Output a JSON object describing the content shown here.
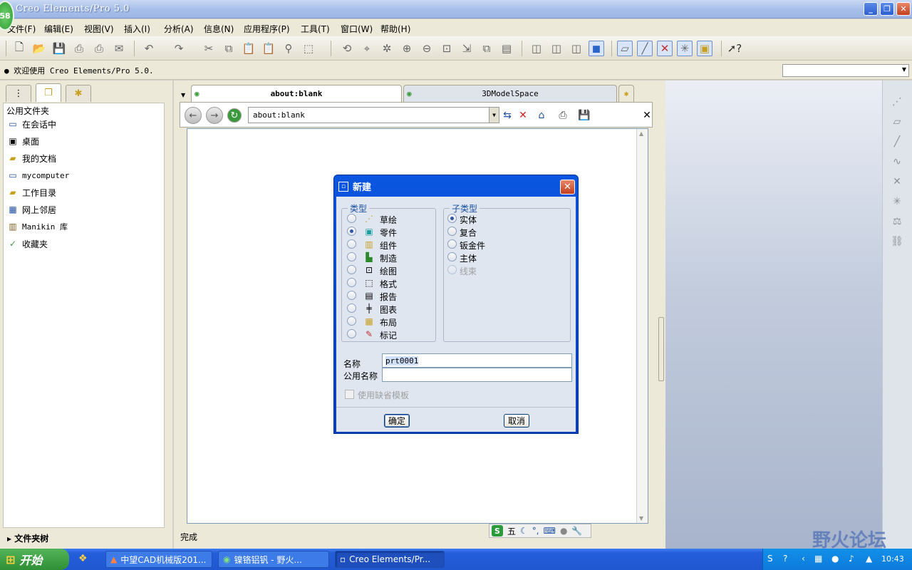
{
  "window": {
    "title": "Creo Elements/Pro 5.0",
    "badge": "58"
  },
  "menu": [
    "文件(F)",
    "编辑(E)",
    "视图(V)",
    "插入(I)",
    "分析(A)",
    "信息(N)",
    "应用程序(P)",
    "工具(T)",
    "窗口(W)",
    "帮助(H)"
  ],
  "message_line": "● 欢迎使用 Creo Elements/Pro 5.0.",
  "navigator": {
    "header": "公用文件夹",
    "items": [
      {
        "label": "在会话中",
        "icon": "monitor-icon"
      },
      {
        "label": "桌面",
        "icon": "desktop-icon"
      },
      {
        "label": "我的文档",
        "icon": "documents-icon"
      },
      {
        "label": "mycomputer",
        "icon": "computer-icon"
      },
      {
        "label": "工作目录",
        "icon": "working-directory-icon"
      },
      {
        "label": "网上邻居",
        "icon": "network-icon"
      },
      {
        "label": "Manikin 库",
        "icon": "library-icon"
      },
      {
        "label": "收藏夹",
        "icon": "favorites-icon"
      }
    ],
    "folder_tree": "▸ 文件夹树"
  },
  "browser": {
    "tabs": [
      "about:blank",
      "3DModelSpace"
    ],
    "address": "about:blank",
    "status": "完成"
  },
  "dialog": {
    "title": "新建",
    "type_group": "类型",
    "subtype_group": "子类型",
    "types": [
      {
        "label": "草绘",
        "icon": "sketch-icon",
        "selected": false
      },
      {
        "label": "零件",
        "icon": "part-icon",
        "selected": true
      },
      {
        "label": "组件",
        "icon": "assembly-icon",
        "selected": false
      },
      {
        "label": "制造",
        "icon": "manufacturing-icon",
        "selected": false
      },
      {
        "label": "绘图",
        "icon": "drawing-icon",
        "selected": false
      },
      {
        "label": "格式",
        "icon": "format-icon",
        "selected": false
      },
      {
        "label": "报告",
        "icon": "report-icon",
        "selected": false
      },
      {
        "label": "图表",
        "icon": "diagram-icon",
        "selected": false
      },
      {
        "label": "布局",
        "icon": "layout-icon",
        "selected": false
      },
      {
        "label": "标记",
        "icon": "markup-icon",
        "selected": false
      }
    ],
    "subtypes": [
      {
        "label": "实体",
        "selected": true,
        "enabled": true
      },
      {
        "label": "复合",
        "selected": false,
        "enabled": true
      },
      {
        "label": "钣金件",
        "selected": false,
        "enabled": true
      },
      {
        "label": "主体",
        "selected": false,
        "enabled": true
      },
      {
        "label": "线束",
        "selected": false,
        "enabled": false
      }
    ],
    "name_label": "名称",
    "name_value": "prt0001",
    "common_name_label": "公用名称",
    "common_name_value": "",
    "use_default_template": "使用缺省模板",
    "ok": "确定",
    "cancel": "取消"
  },
  "ime": {
    "mode": "五"
  },
  "taskbar": {
    "start": "开始",
    "tasks": [
      "中望CAD机械版201...",
      "镍铬铝钒 - 野火...",
      "Creo Elements/Pr..."
    ],
    "clock": "10:43"
  },
  "watermark": "野火论坛"
}
